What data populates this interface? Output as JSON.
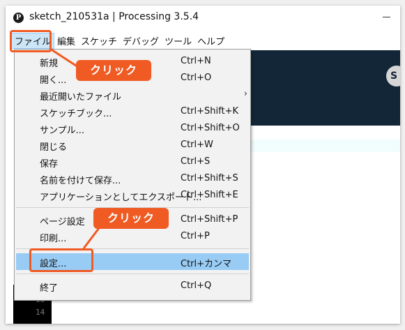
{
  "window": {
    "title": "sketch_210531a | Processing 3.5.4",
    "app_icon_glyph": "P"
  },
  "menubar": {
    "items": [
      "ファイル",
      "編集",
      "スケッチ",
      "デバッグ",
      "ツール",
      "ヘルプ"
    ]
  },
  "file_menu": {
    "items": [
      {
        "label": "新規",
        "shortcut": "Ctrl+N"
      },
      {
        "label": "開く...",
        "shortcut": "Ctrl+O"
      },
      {
        "label": "最近開いたファイル",
        "shortcut": "",
        "submenu_arrow": "›"
      },
      {
        "label": "スケッチブック...",
        "shortcut": "Ctrl+Shift+K"
      },
      {
        "label": "サンプル...",
        "shortcut": "Ctrl+Shift+O"
      },
      {
        "label": "閉じる",
        "shortcut": "Ctrl+W"
      },
      {
        "label": "保存",
        "shortcut": "Ctrl+S"
      },
      {
        "label": "名前を付けて保存...",
        "shortcut": "Ctrl+Shift+S"
      },
      {
        "label": "アプリケーションとしてエクスポート...",
        "shortcut": "Ctrl+Shift+E"
      },
      {
        "label": "ページ設定",
        "shortcut": "Ctrl+Shift+P"
      },
      {
        "label": "印刷...",
        "shortcut": "Ctrl+P"
      },
      {
        "label": "設定...",
        "shortcut": "Ctrl+カンマ"
      },
      {
        "label": "終了",
        "shortcut": "Ctrl+Q"
      }
    ]
  },
  "toolbar": {
    "button_glyph": "S"
  },
  "editor": {
    "line_numbers": [
      "13",
      "14"
    ]
  },
  "annotations": {
    "callout_1": "クリック",
    "callout_2": "クリック"
  },
  "colors": {
    "accent_orange": "#f05a23",
    "toolbar_dark": "#132638",
    "menu_highlight": "#99ccf5"
  }
}
